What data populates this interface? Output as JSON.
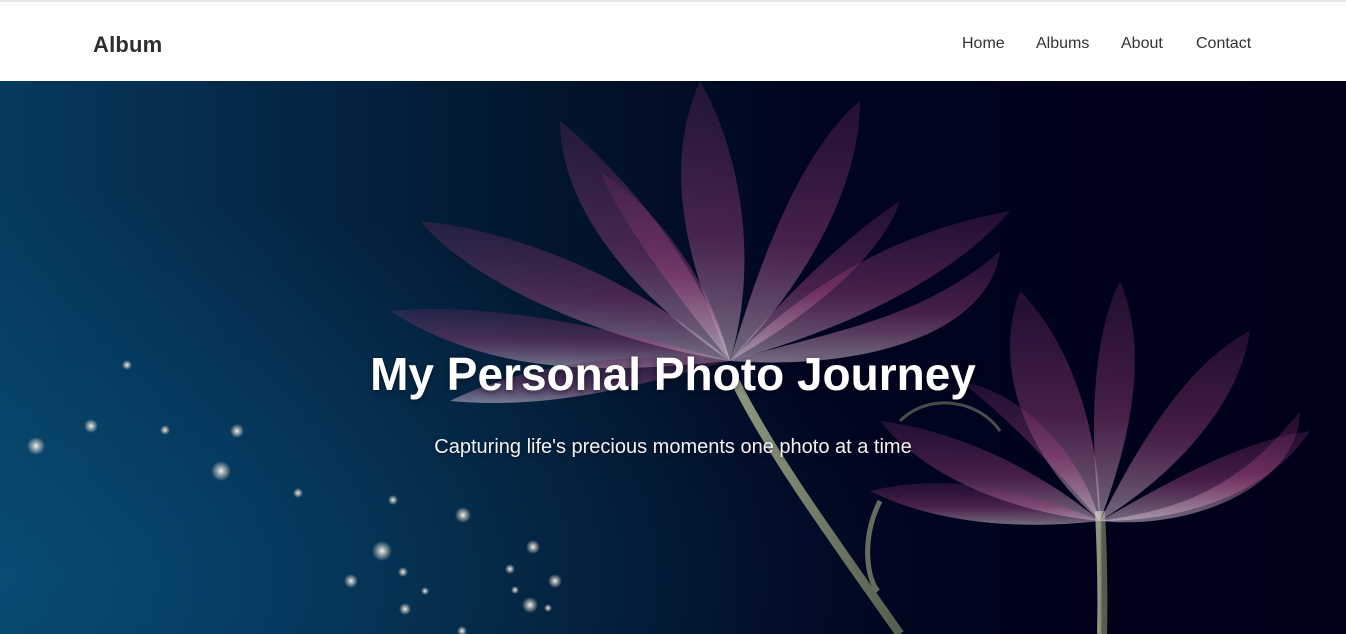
{
  "brand": {
    "name": "Album"
  },
  "nav": {
    "items": [
      {
        "label": "Home"
      },
      {
        "label": "Albums"
      },
      {
        "label": "About"
      },
      {
        "label": "Contact"
      }
    ]
  },
  "hero": {
    "title": "My Personal Photo Journey",
    "subtitle": "Capturing life's precious moments one photo at a time",
    "background_image": "flower-illustration",
    "colors": {
      "deep_blue": "#063a5c",
      "navy": "#000018",
      "petal": "#b04a86",
      "stem": "#8f9a76"
    }
  }
}
